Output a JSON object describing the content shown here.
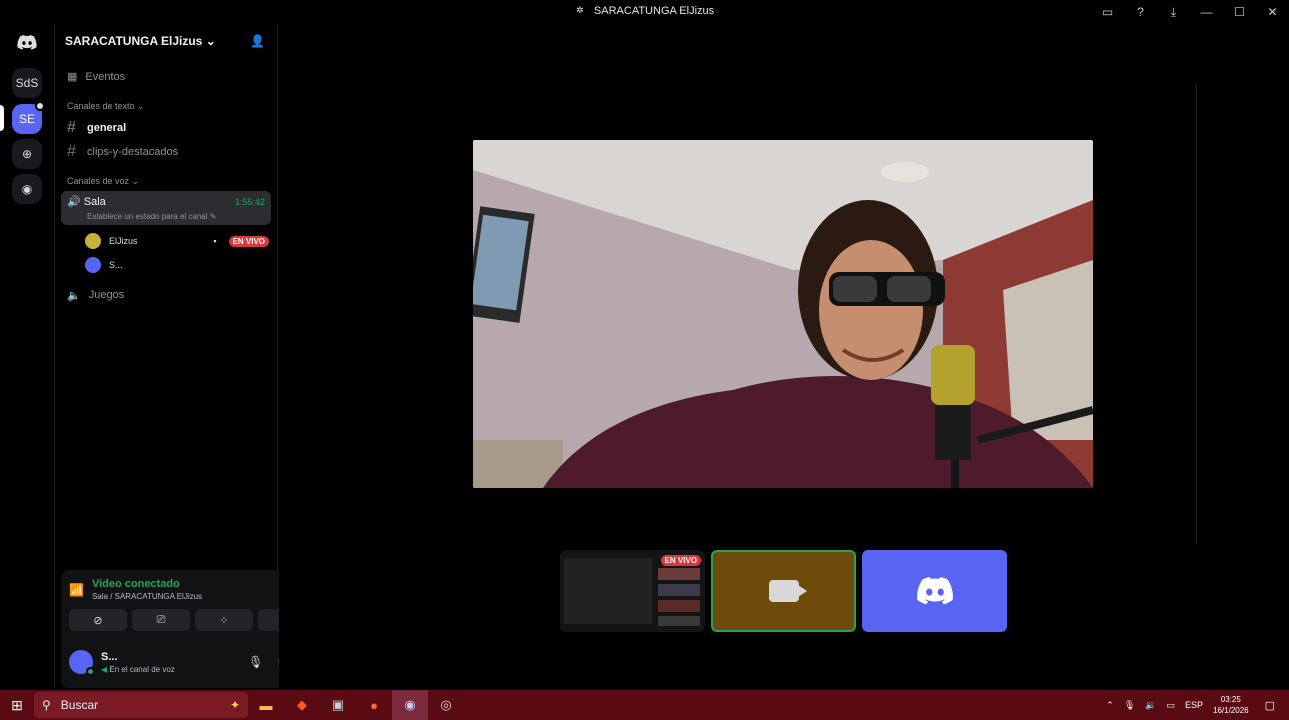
{
  "window": {
    "title": "SARACATUNGA ElJizus"
  },
  "guilds": [
    {
      "label": "SdS"
    },
    {
      "label": "SE"
    }
  ],
  "server": {
    "name": "SARACATUNGA ElJizus",
    "events_label": "Eventos",
    "text_category": "Canales de texto",
    "text_channels": [
      "general",
      "clips-y-destacados"
    ],
    "voice_category": "Canales de voz",
    "voice_channels": [
      {
        "name": "Sala",
        "time": "1:55:42",
        "status_placeholder": "Establece un estado para el canal",
        "members": [
          {
            "name": "ElJizus",
            "live": "EN VIVO"
          },
          {
            "name": "S..."
          }
        ]
      },
      {
        "name": "Juegos"
      }
    ]
  },
  "voice_panel": {
    "status": "Video conectado",
    "location": "Sala / SARACATUNGA ElJizus"
  },
  "user_bar": {
    "name": "S...",
    "status": "En el canal de voz"
  },
  "stream": {
    "thumb_live_badge": "EN VIVO"
  },
  "taskbar": {
    "search_label": "Buscar",
    "language": "ESP",
    "time": "03:25",
    "date": "16/1/2026"
  },
  "colors": {
    "accent": "#5865f2",
    "connected": "#23a55a",
    "live": "#da373c",
    "taskbar": "#5a0a12",
    "camera_tile": "#6e4b0a"
  }
}
